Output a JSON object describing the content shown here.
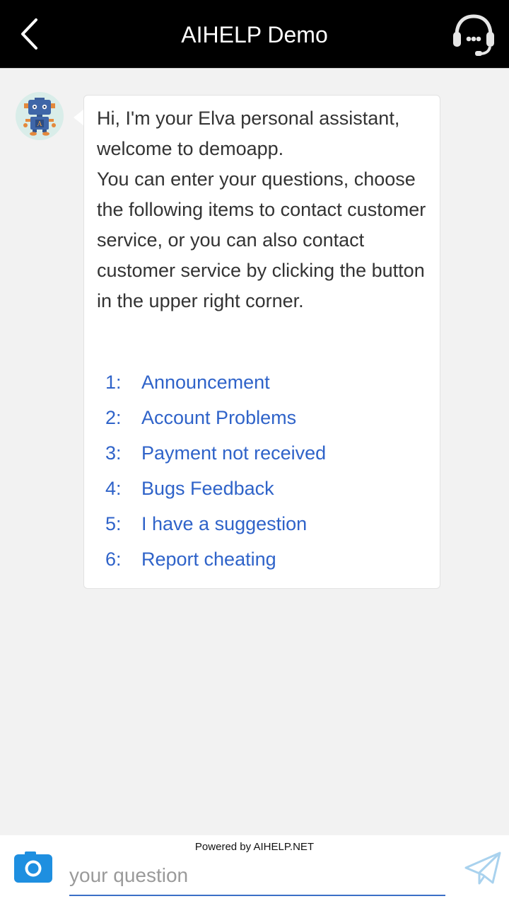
{
  "header": {
    "title": "AIHELP Demo"
  },
  "message": {
    "greeting": "Hi, I'm your Elva personal assistant, welcome to demoapp.\nYou can enter your questions, choose the following items to contact customer service, or you can also contact customer service by clicking the button in the upper right corner.",
    "options": [
      {
        "num": "1:",
        "label": "Announcement"
      },
      {
        "num": "2:",
        "label": "Account Problems"
      },
      {
        "num": "3:",
        "label": "Payment not received"
      },
      {
        "num": "4:",
        "label": "Bugs Feedback"
      },
      {
        "num": "5:",
        "label": "I have a suggestion"
      },
      {
        "num": "6:",
        "label": "Report cheating"
      }
    ]
  },
  "footer": {
    "powered_by": "Powered by AIHELP.NET",
    "input_placeholder": "your question"
  },
  "colors": {
    "header_bg": "#000000",
    "link": "#2f63c9",
    "accent": "#1e8fe0",
    "background": "#f2f2f2"
  },
  "icons": {
    "back": "chevron-left-icon",
    "support": "headset-icon",
    "avatar": "robot-icon",
    "camera": "camera-icon",
    "send": "paper-plane-icon"
  }
}
